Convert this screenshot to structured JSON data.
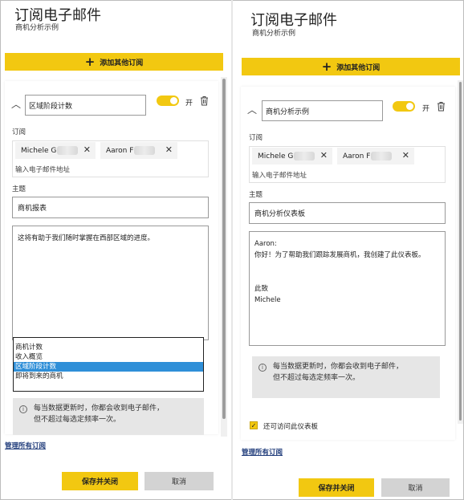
{
  "left": {
    "title": "订阅电子邮件",
    "subtitle": "商机分析示例",
    "add_button": "添加其他订阅",
    "subscription_name": "区域阶段计数",
    "toggle_label": "开",
    "recipients_label": "订阅",
    "recipients": [
      {
        "name": "Michele G"
      },
      {
        "name": "Aaron F"
      }
    ],
    "recipients_placeholder": "输入电子邮件地址",
    "subject_label": "主题",
    "subject": "商机报表",
    "message": "这将有助于我们随时掌握在西部区域的进度。",
    "dropdown_options": [
      "商机计数",
      "收入概览",
      "区域阶段计数",
      "即将到来的商机"
    ],
    "dropdown_selected_index": 2,
    "info_line1": "每当数据更新时，你都会收到电子邮件，",
    "info_line2": "但不超过每选定频率一次。",
    "manage_link": "管理所有订阅",
    "save_button": "保存并关闭",
    "cancel_button": "取消"
  },
  "right": {
    "title": "订阅电子邮件",
    "subtitle": "商机分析示例",
    "add_button": "添加其他订阅",
    "subscription_name": "商机分析示例",
    "toggle_label": "开",
    "recipients_label": "订阅",
    "recipients": [
      {
        "name": "Michele G"
      },
      {
        "name": "Aaron F"
      }
    ],
    "recipients_placeholder": "输入电子邮件地址",
    "subject_label": "主题",
    "subject": "商机分析仪表板",
    "message_lines": [
      "Aaron:",
      "你好！为了帮助我们跟踪发展商机，我创建了此仪表板。",
      "",
      "此致",
      "Michele"
    ],
    "info_line1": "每当数据更新时，你都会收到电子邮件，",
    "info_line2": "但不超过每选定频率一次。",
    "access_label": "还可访问此仪表板",
    "manage_link": "管理所有订阅",
    "save_button": "保存并关闭",
    "cancel_button": "取消"
  },
  "colors": {
    "accent": "#f2c811",
    "selected": "#2f8fd8",
    "link": "#1f3b7a",
    "info_bg": "#e6e6e6"
  }
}
